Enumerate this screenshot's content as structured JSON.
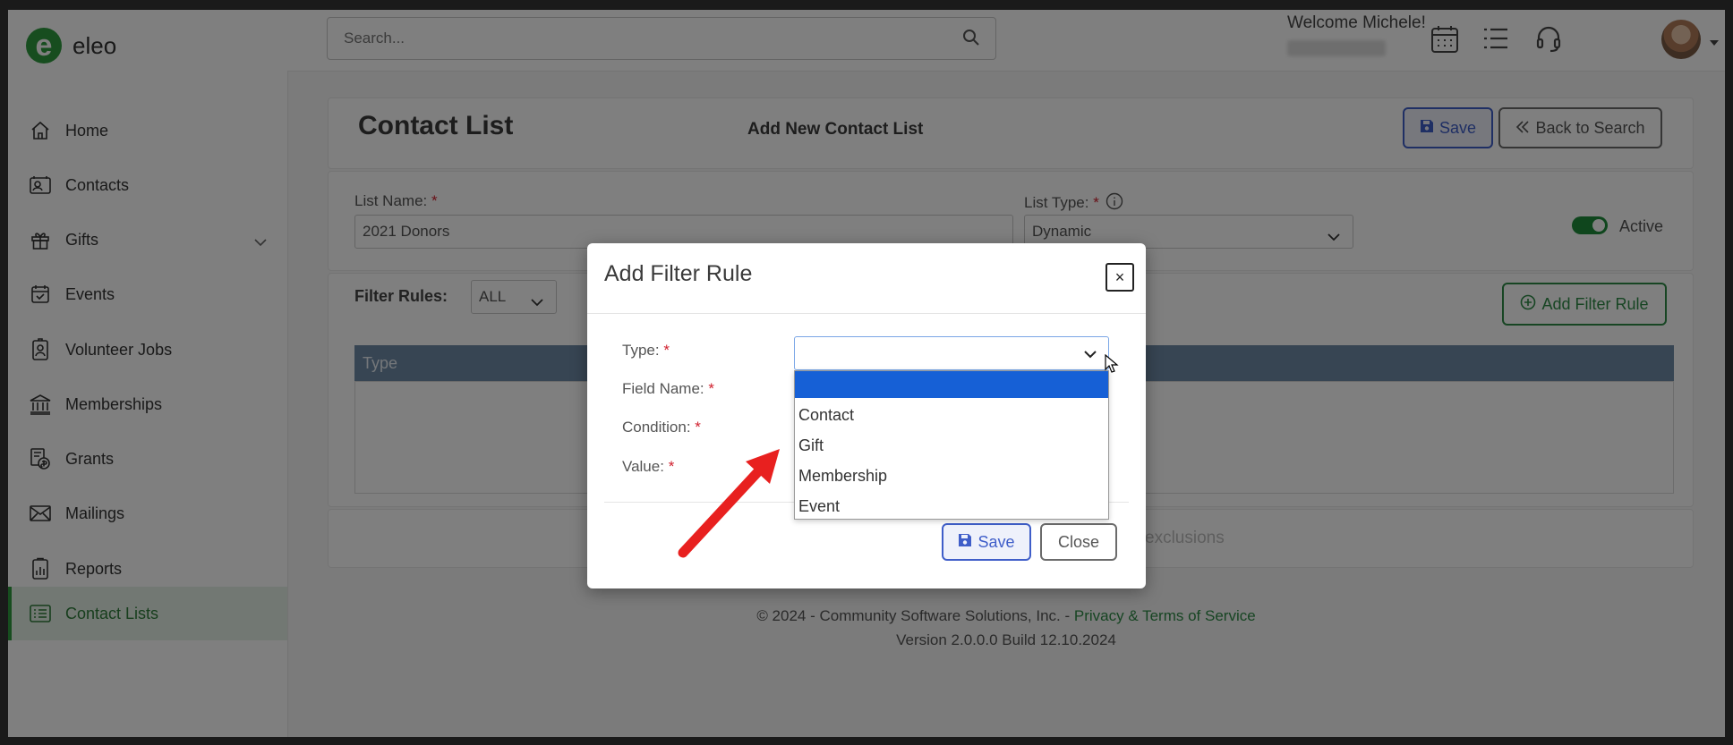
{
  "app": {
    "logo_letter": "e",
    "logo_text": "eleo"
  },
  "sidebar": {
    "items": [
      {
        "label": "Home",
        "icon": "home-icon"
      },
      {
        "label": "Contacts",
        "icon": "contacts-icon"
      },
      {
        "label": "Gifts",
        "icon": "gift-icon"
      },
      {
        "label": "Events",
        "icon": "calendar-check-icon"
      },
      {
        "label": "Volunteer Jobs",
        "icon": "volunteer-badge-icon"
      },
      {
        "label": "Memberships",
        "icon": "bank-icon"
      },
      {
        "label": "Grants",
        "icon": "grants-icon"
      },
      {
        "label": "Mailings",
        "icon": "envelope-icon"
      },
      {
        "label": "Reports",
        "icon": "reports-clipboard-icon"
      },
      {
        "label": "Contact Lists",
        "icon": "list-icon"
      }
    ]
  },
  "topbar": {
    "search_placeholder": "Search...",
    "welcome": "Welcome Michele!"
  },
  "page": {
    "title": "Contact List",
    "subtitle": "Add New Contact List",
    "save_label": "Save",
    "back_label": "Back to Search",
    "list_name_label": "List Name:",
    "list_name_value": "2021 Donors",
    "list_type_label": "List Type:",
    "list_type_value": "Dynamic",
    "active_label": "Active",
    "filter_rules_label": "Filter Rules:",
    "filter_rules_value": "ALL",
    "add_filter_rule_label": "Add Filter Rule",
    "table_header_type": "Type",
    "exclusions_text": "exclusions",
    "required_mark": "*"
  },
  "footer": {
    "copyright": "© 2024 - Community Software Solutions, Inc. - ",
    "privacy_link": "Privacy & Terms of Service",
    "version": "Version 2.0.0.0 Build 12.10.2024"
  },
  "modal": {
    "title": "Add Filter Rule",
    "close_symbol": "×",
    "type_label": "Type:",
    "field_name_label": "Field Name:",
    "condition_label": "Condition:",
    "value_label": "Value:",
    "type_options": [
      "",
      "Contact",
      "Gift",
      "Membership",
      "Event"
    ],
    "save_label": "Save",
    "close_label": "Close"
  },
  "colors": {
    "brand_green": "#2e9b3e",
    "primary_blue": "#3f5ec9",
    "selected_option": "#1660d6",
    "annotation_arrow": "#e8201f"
  }
}
